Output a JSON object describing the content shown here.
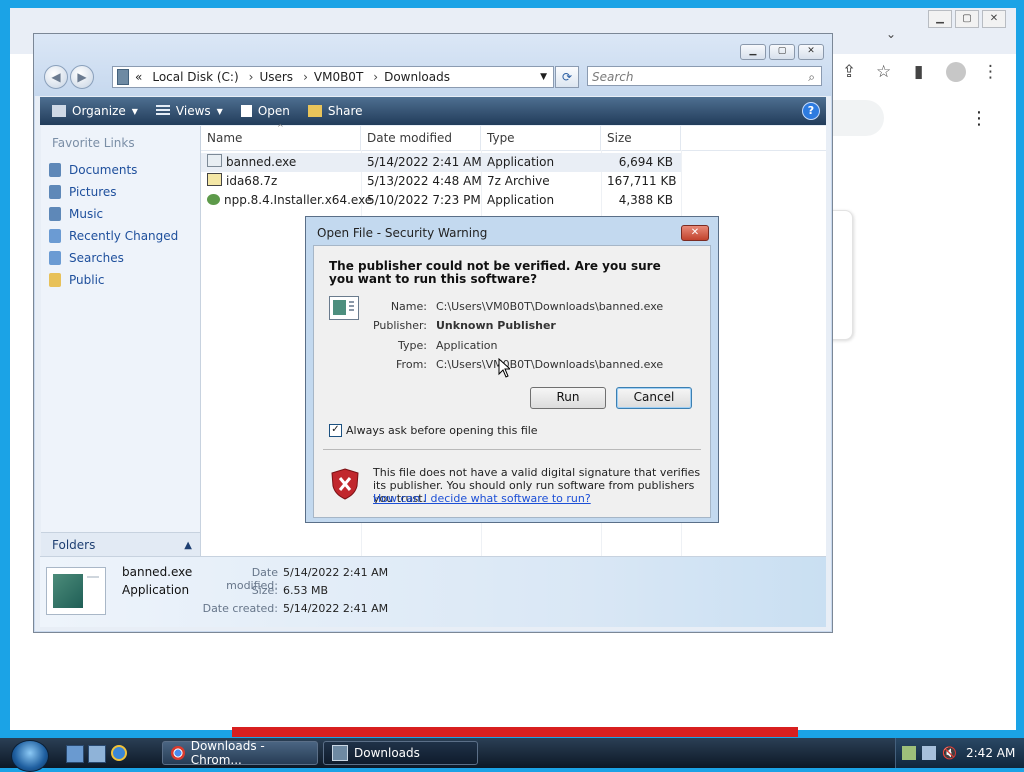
{
  "explorer": {
    "address_crumbs": [
      "Local Disk (C:)",
      "Users",
      "VM0B0T",
      "Downloads"
    ],
    "address_prefix": "«",
    "search_placeholder": "Search",
    "toolbar": {
      "organize": "Organize",
      "views": "Views",
      "open": "Open",
      "share": "Share"
    },
    "favorite_links_title": "Favorite Links",
    "favorites": [
      "Documents",
      "Pictures",
      "Music",
      "Recently Changed",
      "Searches",
      "Public"
    ],
    "folders_label": "Folders",
    "columns": [
      "Name",
      "Date modified",
      "Type",
      "Size"
    ],
    "files": [
      {
        "name": "banned.exe",
        "date": "5/14/2022 2:41 AM",
        "type": "Application",
        "size": "6,694 KB"
      },
      {
        "name": "ida68.7z",
        "date": "5/13/2022 4:48 AM",
        "type": "7z Archive",
        "size": "167,711 KB"
      },
      {
        "name": "npp.8.4.Installer.x64.exe",
        "date": "5/10/2022 7:23 PM",
        "type": "Application",
        "size": "4,388 KB"
      }
    ],
    "details": {
      "name": "banned.exe",
      "type": "Application",
      "date_modified_label": "Date modified:",
      "date_modified": "5/14/2022 2:41 AM",
      "size_label": "Size:",
      "size": "6.53 MB",
      "date_created_label": "Date created:",
      "date_created": "5/14/2022 2:41 AM"
    }
  },
  "dialog": {
    "title": "Open File - Security Warning",
    "heading": "The publisher could not be verified.  Are you sure you want to run this software?",
    "fields": {
      "name_label": "Name:",
      "name": "C:\\Users\\VM0B0T\\Downloads\\banned.exe",
      "publisher_label": "Publisher:",
      "publisher": "Unknown Publisher",
      "type_label": "Type:",
      "type": "Application",
      "from_label": "From:",
      "from": "C:\\Users\\VM0B0T\\Downloads\\banned.exe"
    },
    "run_button": "Run",
    "cancel_button": "Cancel",
    "checkbox_label": "Always ask before opening this file",
    "checkbox_checked": true,
    "warning_text": "This file does not have a valid digital signature that verifies its publisher.  You should only run software from publishers you trust.",
    "warning_link": "How can I decide what software to run?"
  },
  "taskbar": {
    "tasks": [
      "Downloads - Chrom...",
      "Downloads"
    ],
    "clock": "2:42 AM"
  },
  "colors": {
    "desktop": "#1ba3e6",
    "toolbar": "#2b4a6b",
    "link": "#1e4f9c"
  }
}
